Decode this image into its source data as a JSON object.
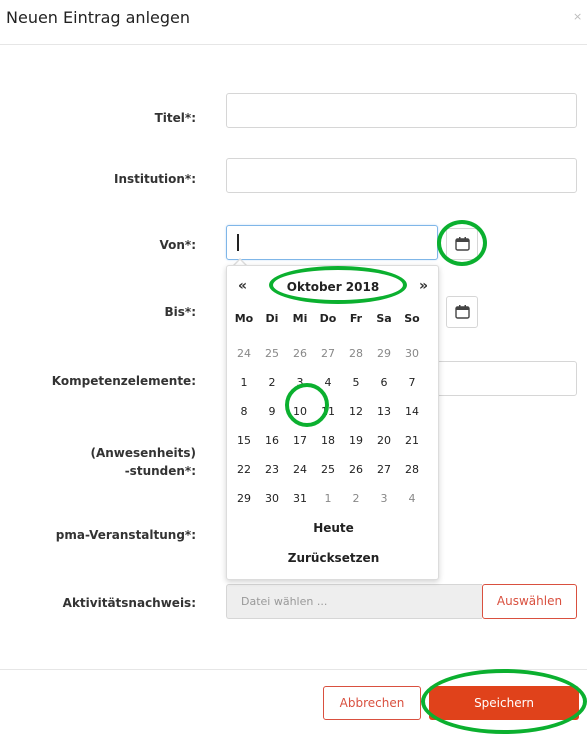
{
  "modal": {
    "title": "Neuen Eintrag anlegen",
    "close": "×"
  },
  "form": {
    "titel_label": "Titel*:",
    "institution_label": "Institution*:",
    "von_label": "Von*:",
    "bis_label": "Bis*:",
    "kompetenz_label": "Kompetenzelemente:",
    "stunden_label_line1": "(Anwesenheits)",
    "stunden_label_line2": "-stunden*:",
    "pma_label": "pma-Veranstaltung*:",
    "aktivitaet_label": "Aktivitätsnachweis:",
    "file_placeholder": "Datei wählen ...",
    "choose_button": "Auswählen"
  },
  "datepicker": {
    "prev": "«",
    "next": "»",
    "month": "Oktober 2018",
    "weekdays": [
      "Mo",
      "Di",
      "Mi",
      "Do",
      "Fr",
      "Sa",
      "So"
    ],
    "weeks": [
      [
        "24",
        "25",
        "26",
        "27",
        "28",
        "29",
        "30"
      ],
      [
        "1",
        "2",
        "3",
        "4",
        "5",
        "6",
        "7"
      ],
      [
        "8",
        "9",
        "10",
        "11",
        "12",
        "13",
        "14"
      ],
      [
        "15",
        "16",
        "17",
        "18",
        "19",
        "20",
        "21"
      ],
      [
        "22",
        "23",
        "24",
        "25",
        "26",
        "27",
        "28"
      ],
      [
        "29",
        "30",
        "31",
        "1",
        "2",
        "3",
        "4"
      ]
    ],
    "today": "Heute",
    "reset": "Zurücksetzen"
  },
  "footer": {
    "cancel": "Abbrechen",
    "save": "Speichern"
  },
  "colors": {
    "accent": "#e0421b",
    "annotation": "#0bb02f",
    "focus": "#7fb6e8"
  }
}
